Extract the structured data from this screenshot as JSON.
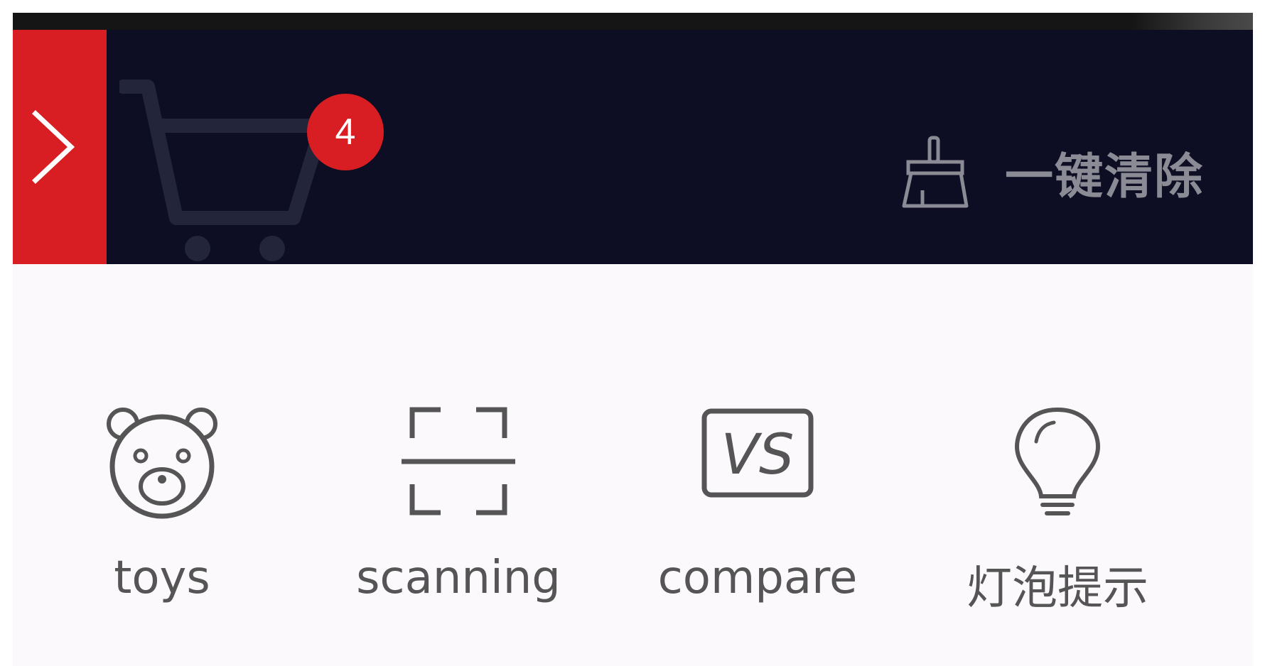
{
  "header": {
    "collapse_icon": "chevron-right-icon",
    "cart_icon": "shopping-cart-icon",
    "cart_count": "4",
    "clear_all_icon": "broom-icon",
    "clear_all_label": "一键清除"
  },
  "tools": [
    {
      "icon": "teddy-bear-icon",
      "label": "toys"
    },
    {
      "icon": "scan-frame-icon",
      "label": "scanning"
    },
    {
      "icon": "vs-compare-icon",
      "label": "compare"
    },
    {
      "icon": "light-bulb-icon",
      "label": "灯泡提示"
    }
  ],
  "colors": {
    "accent_red": "#d81e22",
    "header_bg": "#0d0e24",
    "content_bg": "#fcf9fd",
    "label_gray": "#555555",
    "clear_label_gray": "#8a8b94"
  }
}
